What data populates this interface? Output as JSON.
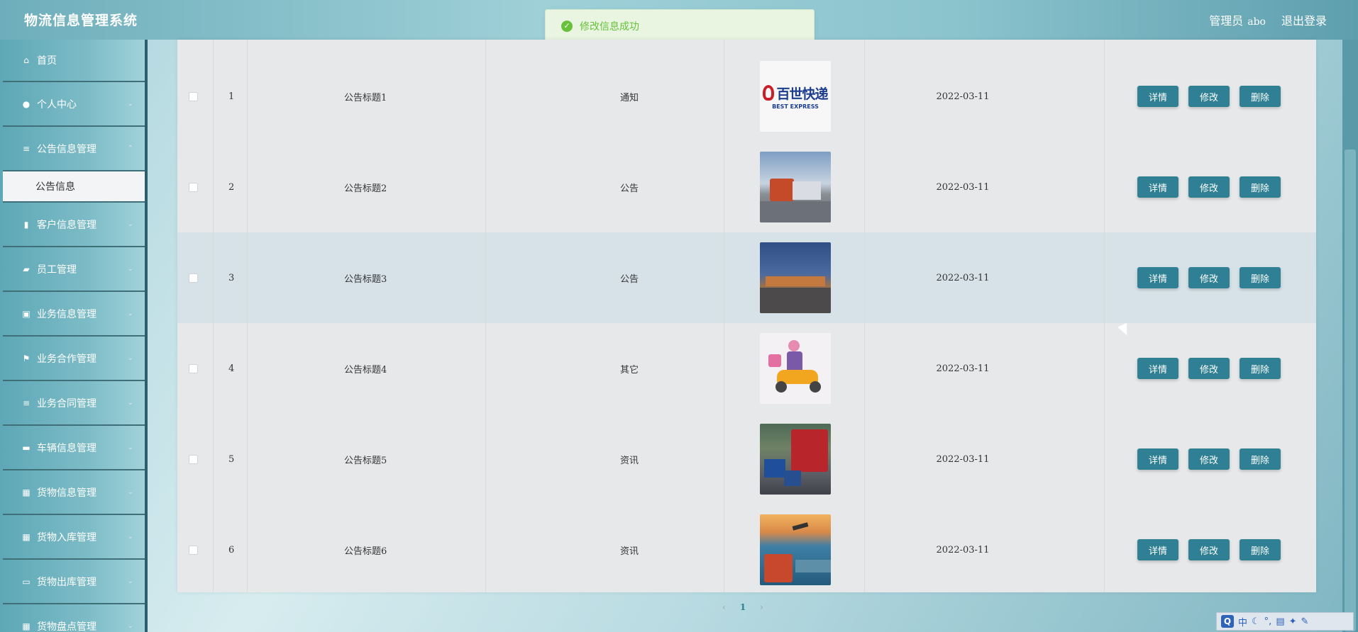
{
  "header": {
    "app_title": "物流信息管理系统",
    "user_role": "管理员",
    "username": "abo",
    "logout_label": "退出登录"
  },
  "toast": {
    "message": "修改信息成功"
  },
  "sidebar": {
    "items": [
      {
        "label": "首页",
        "icon": "home-icon",
        "glyph": "⌂"
      },
      {
        "label": "个人中心",
        "icon": "user-icon",
        "glyph": "●"
      },
      {
        "label": "公告信息管理",
        "icon": "menu-icon",
        "glyph": "≡"
      },
      {
        "label": "公告信息",
        "icon": "",
        "glyph": ""
      },
      {
        "label": "客户信息管理",
        "icon": "chart-icon",
        "glyph": "▮"
      },
      {
        "label": "员工管理",
        "icon": "briefcase-icon",
        "glyph": "▰"
      },
      {
        "label": "业务信息管理",
        "icon": "clipboard-icon",
        "glyph": "▣"
      },
      {
        "label": "业务合作管理",
        "icon": "flag-icon",
        "glyph": "⚑"
      },
      {
        "label": "业务合同管理",
        "icon": "menu-icon",
        "glyph": "≡"
      },
      {
        "label": "车辆信息管理",
        "icon": "monitor-icon",
        "glyph": "▬"
      },
      {
        "label": "货物信息管理",
        "icon": "grid-icon",
        "glyph": "▦"
      },
      {
        "label": "货物入库管理",
        "icon": "grid-icon",
        "glyph": "▦"
      },
      {
        "label": "货物出库管理",
        "icon": "comment-icon",
        "glyph": "▭"
      },
      {
        "label": "货物盘点管理",
        "icon": "grid-icon",
        "glyph": "▦"
      }
    ]
  },
  "table": {
    "rows": [
      {
        "index": "1",
        "title": "公告标题1",
        "type": "通知",
        "date": "2022-03-11",
        "image": "best-express-logo"
      },
      {
        "index": "2",
        "title": "公告标题2",
        "type": "公告",
        "date": "2022-03-11",
        "image": "truck-road-photo"
      },
      {
        "index": "3",
        "title": "公告标题3",
        "type": "公告",
        "date": "2022-03-11",
        "image": "warehouse-dock-photo"
      },
      {
        "index": "4",
        "title": "公告标题4",
        "type": "其它",
        "date": "2022-03-11",
        "image": "courier-scooter-illustration"
      },
      {
        "index": "5",
        "title": "公告标题5",
        "type": "资讯",
        "date": "2022-03-11",
        "image": "red-truck-loading-photo"
      },
      {
        "index": "6",
        "title": "公告标题6",
        "type": "资讯",
        "date": "2022-03-11",
        "image": "truck-plane-ship-photo"
      }
    ],
    "actions": {
      "detail": "详情",
      "edit": "修改",
      "delete": "删除"
    }
  },
  "logo_text": {
    "cn": "百世快递",
    "en": "BEST EXPRESS"
  },
  "pagination": {
    "prev": "‹",
    "current": "1",
    "next": "›"
  },
  "ime": {
    "mode": "中"
  }
}
